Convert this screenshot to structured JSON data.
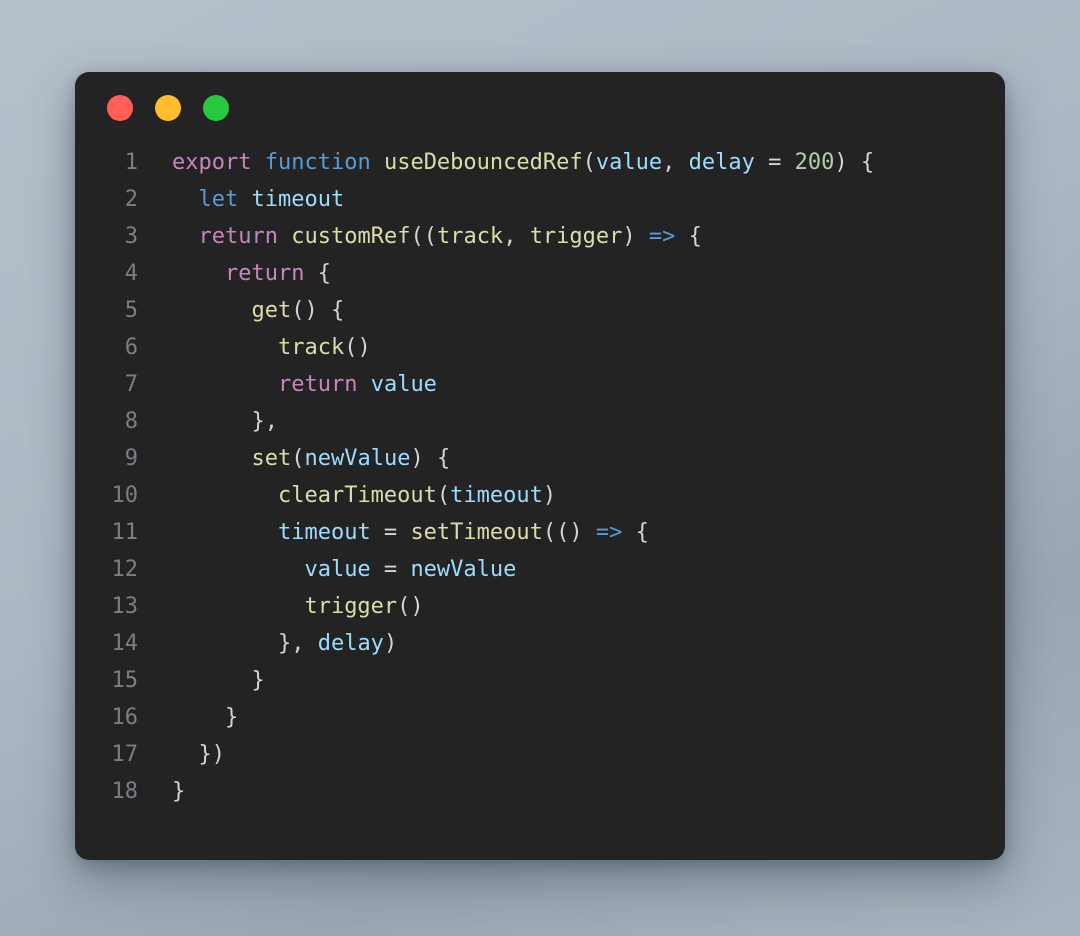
{
  "window": {
    "background_color": "#232323",
    "page_background_color": "#aeb9c5",
    "traffic_lights": [
      {
        "name": "close",
        "label": "Close",
        "color": "#ff5f56"
      },
      {
        "name": "minimize",
        "label": "Minimize",
        "color": "#ffbd2e"
      },
      {
        "name": "zoom",
        "label": "Zoom",
        "color": "#27c93f"
      }
    ]
  },
  "editor": {
    "language": "javascript",
    "line_number_color": "#787f86",
    "default_text_color": "#d4d4d4",
    "syntax_colors": {
      "keyword": "#c586c0",
      "storage": "#569cd6",
      "function": "#dcdcaa",
      "variable": "#9cdcfe",
      "number": "#b5cea8",
      "operator": "#569cd6",
      "plain": "#d4d4d4"
    },
    "lines": [
      {
        "number": "1",
        "text": "export function useDebouncedRef(value, delay = 200) {",
        "tokens": [
          {
            "t": "export",
            "c": "tok-keyword"
          },
          {
            "t": " ",
            "c": "tok-plain"
          },
          {
            "t": "function",
            "c": "tok-storage"
          },
          {
            "t": " ",
            "c": "tok-plain"
          },
          {
            "t": "useDebouncedRef",
            "c": "tok-function"
          },
          {
            "t": "(",
            "c": "tok-punct"
          },
          {
            "t": "value",
            "c": "tok-variable"
          },
          {
            "t": ", ",
            "c": "tok-punct"
          },
          {
            "t": "delay",
            "c": "tok-variable"
          },
          {
            "t": " = ",
            "c": "tok-punct"
          },
          {
            "t": "200",
            "c": "tok-number"
          },
          {
            "t": ") {",
            "c": "tok-punct"
          }
        ]
      },
      {
        "number": "2",
        "text": "  let timeout",
        "tokens": [
          {
            "t": "  ",
            "c": "tok-plain"
          },
          {
            "t": "let",
            "c": "tok-storage"
          },
          {
            "t": " ",
            "c": "tok-plain"
          },
          {
            "t": "timeout",
            "c": "tok-variable"
          }
        ]
      },
      {
        "number": "3",
        "text": "  return customRef((track, trigger) => {",
        "tokens": [
          {
            "t": "  ",
            "c": "tok-plain"
          },
          {
            "t": "return",
            "c": "tok-keyword"
          },
          {
            "t": " ",
            "c": "tok-plain"
          },
          {
            "t": "customRef",
            "c": "tok-function"
          },
          {
            "t": "((",
            "c": "tok-punct"
          },
          {
            "t": "track",
            "c": "tok-function"
          },
          {
            "t": ", ",
            "c": "tok-punct"
          },
          {
            "t": "trigger",
            "c": "tok-function"
          },
          {
            "t": ") ",
            "c": "tok-punct"
          },
          {
            "t": "=>",
            "c": "tok-operator"
          },
          {
            "t": " {",
            "c": "tok-punct"
          }
        ]
      },
      {
        "number": "4",
        "text": "    return {",
        "tokens": [
          {
            "t": "    ",
            "c": "tok-plain"
          },
          {
            "t": "return",
            "c": "tok-keyword"
          },
          {
            "t": " {",
            "c": "tok-punct"
          }
        ]
      },
      {
        "number": "5",
        "text": "      get() {",
        "tokens": [
          {
            "t": "      ",
            "c": "tok-plain"
          },
          {
            "t": "get",
            "c": "tok-function"
          },
          {
            "t": "() {",
            "c": "tok-punct"
          }
        ]
      },
      {
        "number": "6",
        "text": "        track()",
        "tokens": [
          {
            "t": "        ",
            "c": "tok-plain"
          },
          {
            "t": "track",
            "c": "tok-function"
          },
          {
            "t": "()",
            "c": "tok-punct"
          }
        ]
      },
      {
        "number": "7",
        "text": "        return value",
        "tokens": [
          {
            "t": "        ",
            "c": "tok-plain"
          },
          {
            "t": "return",
            "c": "tok-keyword"
          },
          {
            "t": " ",
            "c": "tok-plain"
          },
          {
            "t": "value",
            "c": "tok-variable"
          }
        ]
      },
      {
        "number": "8",
        "text": "      },",
        "tokens": [
          {
            "t": "      },",
            "c": "tok-punct"
          }
        ]
      },
      {
        "number": "9",
        "text": "      set(newValue) {",
        "tokens": [
          {
            "t": "      ",
            "c": "tok-plain"
          },
          {
            "t": "set",
            "c": "tok-function"
          },
          {
            "t": "(",
            "c": "tok-punct"
          },
          {
            "t": "newValue",
            "c": "tok-variable"
          },
          {
            "t": ") {",
            "c": "tok-punct"
          }
        ]
      },
      {
        "number": "10",
        "text": "        clearTimeout(timeout)",
        "tokens": [
          {
            "t": "        ",
            "c": "tok-plain"
          },
          {
            "t": "clearTimeout",
            "c": "tok-function"
          },
          {
            "t": "(",
            "c": "tok-punct"
          },
          {
            "t": "timeout",
            "c": "tok-variable"
          },
          {
            "t": ")",
            "c": "tok-punct"
          }
        ]
      },
      {
        "number": "11",
        "text": "        timeout = setTimeout(() => {",
        "tokens": [
          {
            "t": "        ",
            "c": "tok-plain"
          },
          {
            "t": "timeout",
            "c": "tok-variable"
          },
          {
            "t": " = ",
            "c": "tok-punct"
          },
          {
            "t": "setTimeout",
            "c": "tok-function"
          },
          {
            "t": "(() ",
            "c": "tok-punct"
          },
          {
            "t": "=>",
            "c": "tok-operator"
          },
          {
            "t": " {",
            "c": "tok-punct"
          }
        ]
      },
      {
        "number": "12",
        "text": "          value = newValue",
        "tokens": [
          {
            "t": "          ",
            "c": "tok-plain"
          },
          {
            "t": "value",
            "c": "tok-variable"
          },
          {
            "t": " = ",
            "c": "tok-punct"
          },
          {
            "t": "newValue",
            "c": "tok-variable"
          }
        ]
      },
      {
        "number": "13",
        "text": "          trigger()",
        "tokens": [
          {
            "t": "          ",
            "c": "tok-plain"
          },
          {
            "t": "trigger",
            "c": "tok-function"
          },
          {
            "t": "()",
            "c": "tok-punct"
          }
        ]
      },
      {
        "number": "14",
        "text": "        }, delay)",
        "tokens": [
          {
            "t": "        }, ",
            "c": "tok-punct"
          },
          {
            "t": "delay",
            "c": "tok-variable"
          },
          {
            "t": ")",
            "c": "tok-punct"
          }
        ]
      },
      {
        "number": "15",
        "text": "      }",
        "tokens": [
          {
            "t": "      }",
            "c": "tok-punct"
          }
        ]
      },
      {
        "number": "16",
        "text": "    }",
        "tokens": [
          {
            "t": "    }",
            "c": "tok-punct"
          }
        ]
      },
      {
        "number": "17",
        "text": "  })",
        "tokens": [
          {
            "t": "  })",
            "c": "tok-punct"
          }
        ]
      },
      {
        "number": "18",
        "text": "}",
        "tokens": [
          {
            "t": "}",
            "c": "tok-punct"
          }
        ]
      }
    ]
  }
}
